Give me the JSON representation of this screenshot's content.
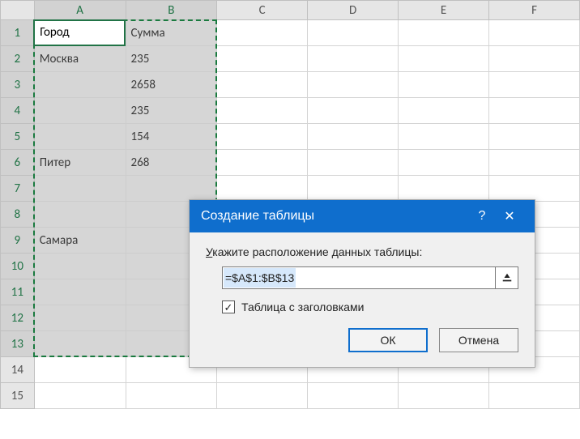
{
  "columns": [
    "A",
    "B",
    "C",
    "D",
    "E",
    "F"
  ],
  "row_count": 15,
  "selected_cols": [
    "A",
    "B"
  ],
  "selected_rows": [
    1,
    2,
    3,
    4,
    5,
    6,
    7,
    8,
    9,
    10,
    11,
    12,
    13
  ],
  "active_cell_text": "Город",
  "cells": {
    "A1": "Город",
    "B1": "Сумма",
    "A2": "Москва",
    "B2": "235",
    "B3": "2658",
    "B4": "235",
    "B5": "154",
    "A6": "Питер",
    "B6": "268",
    "A9": "Самара"
  },
  "numeric_cols": [
    "B"
  ],
  "col_widths": {
    "row": 42,
    "A": 114,
    "B": 114,
    "C": 114,
    "D": 114,
    "E": 114,
    "F": 114
  },
  "dialog": {
    "title": "Создание таблицы",
    "label_prefix": "У",
    "label_rest": "кажите расположение данных таблицы:",
    "range_value": "=$A$1:$B$13",
    "checkbox_checked": true,
    "checkbox_prefix": "Т",
    "checkbox_rest": "аблица с заголовками",
    "ok": "ОК",
    "cancel": "Отмена",
    "help": "?",
    "close": "✕"
  }
}
